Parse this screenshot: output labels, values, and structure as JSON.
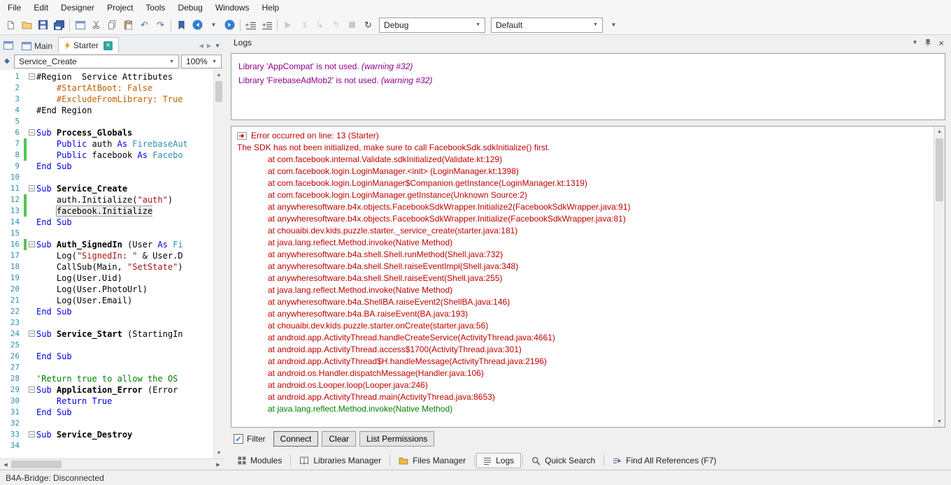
{
  "menu": {
    "items": [
      "File",
      "Edit",
      "Designer",
      "Project",
      "Tools",
      "Debug",
      "Windows",
      "Help"
    ]
  },
  "toolbar": {
    "items": [
      {
        "type": "icon",
        "name": "new-icon",
        "icon": "page"
      },
      {
        "type": "icon",
        "name": "open-icon",
        "icon": "folder"
      },
      {
        "type": "icon",
        "name": "save-icon",
        "icon": "floppy"
      },
      {
        "type": "icon",
        "name": "save-all-icon",
        "icon": "floppy-all"
      },
      {
        "type": "sep"
      },
      {
        "type": "icon",
        "name": "designer-icon",
        "icon": "form"
      },
      {
        "type": "icon",
        "name": "cut-icon",
        "icon": "scissors"
      },
      {
        "type": "icon",
        "name": "copy-icon",
        "icon": "copy"
      },
      {
        "type": "icon",
        "name": "paste-icon",
        "icon": "paste"
      },
      {
        "type": "icon",
        "name": "undo-icon",
        "icon": "undo"
      },
      {
        "type": "icon",
        "name": "redo-icon",
        "icon": "redo"
      },
      {
        "type": "sep"
      },
      {
        "type": "icon",
        "name": "bookmark-icon",
        "icon": "bookmark"
      },
      {
        "type": "icon",
        "name": "navigate-back-icon",
        "icon": "circle-left"
      },
      {
        "type": "icon",
        "name": "back-history-dropdown-icon",
        "icon": "chev-down-sm"
      },
      {
        "type": "icon",
        "name": "navigate-forward-icon",
        "icon": "circle-right"
      },
      {
        "type": "sep"
      },
      {
        "type": "icon",
        "name": "outdent-icon",
        "icon": "outdent"
      },
      {
        "type": "icon",
        "name": "indent-icon",
        "icon": "indent"
      },
      {
        "type": "sep"
      },
      {
        "type": "icon",
        "name": "run-icon",
        "icon": "play",
        "disabled": true
      },
      {
        "type": "icon",
        "name": "step-into-icon",
        "icon": "step",
        "disabled": true
      },
      {
        "type": "icon",
        "name": "step-over-icon",
        "icon": "step2",
        "disabled": true
      },
      {
        "type": "icon",
        "name": "step-out-icon",
        "icon": "step3",
        "disabled": true
      },
      {
        "type": "icon",
        "name": "stop-icon",
        "icon": "stop",
        "disabled": true
      },
      {
        "type": "icon",
        "name": "rebuild-icon",
        "icon": "refresh"
      },
      {
        "type": "dropdown",
        "name": "build-config-dropdown",
        "label": "Debug",
        "width": 152
      },
      {
        "type": "dropdown",
        "name": "build-profile-dropdown",
        "label": "Default",
        "width": 160
      },
      {
        "type": "icon",
        "name": "toolbar-overflow-icon",
        "icon": "chev-down-sm"
      }
    ]
  },
  "tabs": {
    "items": [
      {
        "label": "Main",
        "icon": "form",
        "active": false
      },
      {
        "label": "Starter",
        "icon": "flash",
        "active": true,
        "closable": true
      }
    ]
  },
  "editor": {
    "nav_dropdown": "Service_Create",
    "zoom": "100%",
    "lines": [
      {
        "n": 1,
        "fold": true,
        "s": [
          [
            "#Region  Service Attributes",
            "plain"
          ]
        ]
      },
      {
        "n": 2,
        "s": [
          [
            "    ",
            "plain"
          ],
          [
            "#StartAtBoot: False",
            "attr"
          ]
        ]
      },
      {
        "n": 3,
        "s": [
          [
            "    ",
            "plain"
          ],
          [
            "#ExcludeFromLibrary: True",
            "attr"
          ]
        ]
      },
      {
        "n": 4,
        "s": [
          [
            "#End Region",
            "plain"
          ]
        ]
      },
      {
        "n": 5,
        "s": []
      },
      {
        "n": 6,
        "fold": true,
        "s": [
          [
            "Sub ",
            "kw"
          ],
          [
            "Process_Globals",
            "subname"
          ]
        ]
      },
      {
        "n": 7,
        "bar": true,
        "s": [
          [
            "    ",
            "plain"
          ],
          [
            "Public ",
            "kw"
          ],
          [
            "auth ",
            "plain"
          ],
          [
            "As ",
            "kw"
          ],
          [
            "FirebaseAut",
            "type"
          ]
        ]
      },
      {
        "n": 8,
        "bar": true,
        "s": [
          [
            "    ",
            "plain"
          ],
          [
            "Public ",
            "kw"
          ],
          [
            "facebook ",
            "plain"
          ],
          [
            "As ",
            "kw"
          ],
          [
            "Facebo",
            "type"
          ]
        ]
      },
      {
        "n": 9,
        "s": [
          [
            "End Sub",
            "kw"
          ]
        ]
      },
      {
        "n": 10,
        "s": []
      },
      {
        "n": 11,
        "fold": true,
        "s": [
          [
            "Sub ",
            "kw"
          ],
          [
            "Service_Create",
            "subname"
          ]
        ]
      },
      {
        "n": 12,
        "bar": true,
        "s": [
          [
            "    auth.Initialize(",
            "plain"
          ],
          [
            "\"auth\"",
            "str"
          ],
          [
            ")",
            "plain"
          ]
        ]
      },
      {
        "n": 13,
        "bar": true,
        "s": [
          [
            "    ",
            "plain"
          ],
          [
            "facebook.Initialize",
            "plain box"
          ]
        ]
      },
      {
        "n": 14,
        "s": [
          [
            "End Sub",
            "kw"
          ]
        ]
      },
      {
        "n": 15,
        "s": []
      },
      {
        "n": 16,
        "bar": true,
        "fold": true,
        "s": [
          [
            "Sub ",
            "kw"
          ],
          [
            "Auth_SignedIn ",
            "subname"
          ],
          [
            "(User ",
            "plain"
          ],
          [
            "As ",
            "kw"
          ],
          [
            "Fi",
            "type"
          ]
        ]
      },
      {
        "n": 17,
        "s": [
          [
            "    Log(",
            "plain"
          ],
          [
            "\"SignedIn: \"",
            "str"
          ],
          [
            " & User.D",
            "plain"
          ]
        ]
      },
      {
        "n": 18,
        "s": [
          [
            "    CallSub(Main, ",
            "plain"
          ],
          [
            "\"SetState\"",
            "str"
          ],
          [
            ")",
            "plain"
          ]
        ]
      },
      {
        "n": 19,
        "s": [
          [
            "    Log(User.Uid)",
            "plain"
          ]
        ]
      },
      {
        "n": 20,
        "s": [
          [
            "    Log(User.PhotoUrl)",
            "plain"
          ]
        ]
      },
      {
        "n": 21,
        "s": [
          [
            "    Log(User.Email)",
            "plain"
          ]
        ]
      },
      {
        "n": 22,
        "s": [
          [
            "End Sub",
            "kw"
          ]
        ]
      },
      {
        "n": 23,
        "s": []
      },
      {
        "n": 24,
        "fold": true,
        "s": [
          [
            "Sub ",
            "kw"
          ],
          [
            "Service_Start ",
            "subname"
          ],
          [
            "(StartingIn",
            "plain"
          ]
        ]
      },
      {
        "n": 25,
        "s": []
      },
      {
        "n": 26,
        "s": [
          [
            "End Sub",
            "kw"
          ]
        ]
      },
      {
        "n": 27,
        "s": []
      },
      {
        "n": 28,
        "s": [
          [
            "'Return true to allow the OS ",
            "comment"
          ]
        ]
      },
      {
        "n": 29,
        "fold": true,
        "s": [
          [
            "Sub ",
            "kw"
          ],
          [
            "Application_Error ",
            "subname"
          ],
          [
            "(Error ",
            "plain"
          ]
        ]
      },
      {
        "n": 30,
        "s": [
          [
            "    ",
            "plain"
          ],
          [
            "Return True",
            "kw"
          ]
        ]
      },
      {
        "n": 31,
        "s": [
          [
            "End Sub",
            "kw"
          ]
        ]
      },
      {
        "n": 32,
        "s": []
      },
      {
        "n": 33,
        "fold": true,
        "s": [
          [
            "Sub ",
            "kw"
          ],
          [
            "Service_Destroy",
            "subname"
          ]
        ]
      },
      {
        "n": 34,
        "s": []
      }
    ]
  },
  "logs": {
    "title": "Logs",
    "warnings": [
      {
        "text": "Library 'AppCompat' is not used.",
        "note": "(warning #32)"
      },
      {
        "text": "Library 'FirebaseAdMob2' is not used.",
        "note": "(warning #32)"
      }
    ],
    "error": {
      "header": "Error occurred on line: 13 (Starter)",
      "message": "The SDK has not been initialized, make sure to call FacebookSdk.sdkInitialize() first.",
      "stack": [
        {
          "t": "at com.facebook.internal.Validate.sdkInitialized(Validate.kt:129)",
          "c": "red"
        },
        {
          "t": "at com.facebook.login.LoginManager.<init> (LoginManager.kt:1398)",
          "c": "red"
        },
        {
          "t": "at com.facebook.login.LoginManager$Companion.getInstance(LoginManager.kt:1319)",
          "c": "red"
        },
        {
          "t": "at com.facebook.login.LoginManager.getInstance(Unknown Source:2)",
          "c": "red"
        },
        {
          "t": "at anywheresoftware.b4x.objects.FacebookSdkWrapper.Initialize2(FacebookSdkWrapper.java:91)",
          "c": "red"
        },
        {
          "t": "at anywheresoftware.b4x.objects.FacebookSdkWrapper.Initialize(FacebookSdkWrapper.java:81)",
          "c": "red"
        },
        {
          "t": "at chouaibi.dev.kids.puzzle.starter._service_create(starter.java:181)",
          "c": "red"
        },
        {
          "t": "at java.lang.reflect.Method.invoke(Native Method)",
          "c": "red"
        },
        {
          "t": "at anywheresoftware.b4a.shell.Shell.runMethod(Shell.java:732)",
          "c": "red"
        },
        {
          "t": "at anywheresoftware.b4a.shell.Shell.raiseEventImpl(Shell.java:348)",
          "c": "red"
        },
        {
          "t": "at anywheresoftware.b4a.shell.Shell.raiseEvent(Shell.java:255)",
          "c": "red"
        },
        {
          "t": "at java.lang.reflect.Method.invoke(Native Method)",
          "c": "red"
        },
        {
          "t": "at anywheresoftware.b4a.ShellBA.raiseEvent2(ShellBA.java:146)",
          "c": "red"
        },
        {
          "t": "at anywheresoftware.b4a.BA.raiseEvent(BA.java:193)",
          "c": "red"
        },
        {
          "t": "at chouaibi.dev.kids.puzzle.starter.onCreate(starter.java:56)",
          "c": "red"
        },
        {
          "t": "at android.app.ActivityThread.handleCreateService(ActivityThread.java:4661)",
          "c": "red"
        },
        {
          "t": "at android.app.ActivityThread.access$1700(ActivityThread.java:301)",
          "c": "red"
        },
        {
          "t": "at android.app.ActivityThread$H.handleMessage(ActivityThread.java:2196)",
          "c": "red"
        },
        {
          "t": "at android.os.Handler.dispatchMessage(Handler.java:106)",
          "c": "red"
        },
        {
          "t": "at android.os.Looper.loop(Looper.java:246)",
          "c": "red"
        },
        {
          "t": "at android.app.ActivityThread.main(ActivityThread.java:8653)",
          "c": "red"
        },
        {
          "t": "at java.lang.reflect.Method.invoke(Native Method)",
          "c": "green"
        }
      ]
    },
    "filter": {
      "label": "Filter",
      "checked": true,
      "buttons": [
        {
          "name": "connect-button",
          "label": "Connect"
        },
        {
          "name": "clear-button",
          "label": "Clear"
        },
        {
          "name": "list-permissions-button",
          "label": "List Permissions"
        }
      ]
    }
  },
  "bottom_tabs": [
    {
      "id": "modules",
      "label": "Modules",
      "icon": "modules"
    },
    {
      "id": "libraries-manager",
      "label": "Libraries Manager",
      "icon": "book"
    },
    {
      "id": "files-manager",
      "label": "Files Manager",
      "icon": "folder-sm"
    },
    {
      "id": "logs",
      "label": "Logs",
      "icon": "logs-list",
      "active": true
    },
    {
      "id": "quick-search",
      "label": "Quick Search",
      "icon": "search"
    },
    {
      "id": "find-all-references",
      "label": "Find All References (F7)",
      "icon": "findref"
    }
  ],
  "status": {
    "text": "B4A-Bridge: Disconnected"
  },
  "colors": {
    "keyword": "#0000E0",
    "type": "#2B91AF",
    "string": "#A31515",
    "comment": "#008000",
    "attribute": "#C06000",
    "warning_purple": "#8B008B",
    "error_red": "#C00000",
    "stack_green": "#008000",
    "accent_blue": "#2F80CF",
    "change_bar_green": "#53C653",
    "starter_tab_icon_orange": "#EF8F1F",
    "tab_close_teal": "#2FA79E"
  }
}
